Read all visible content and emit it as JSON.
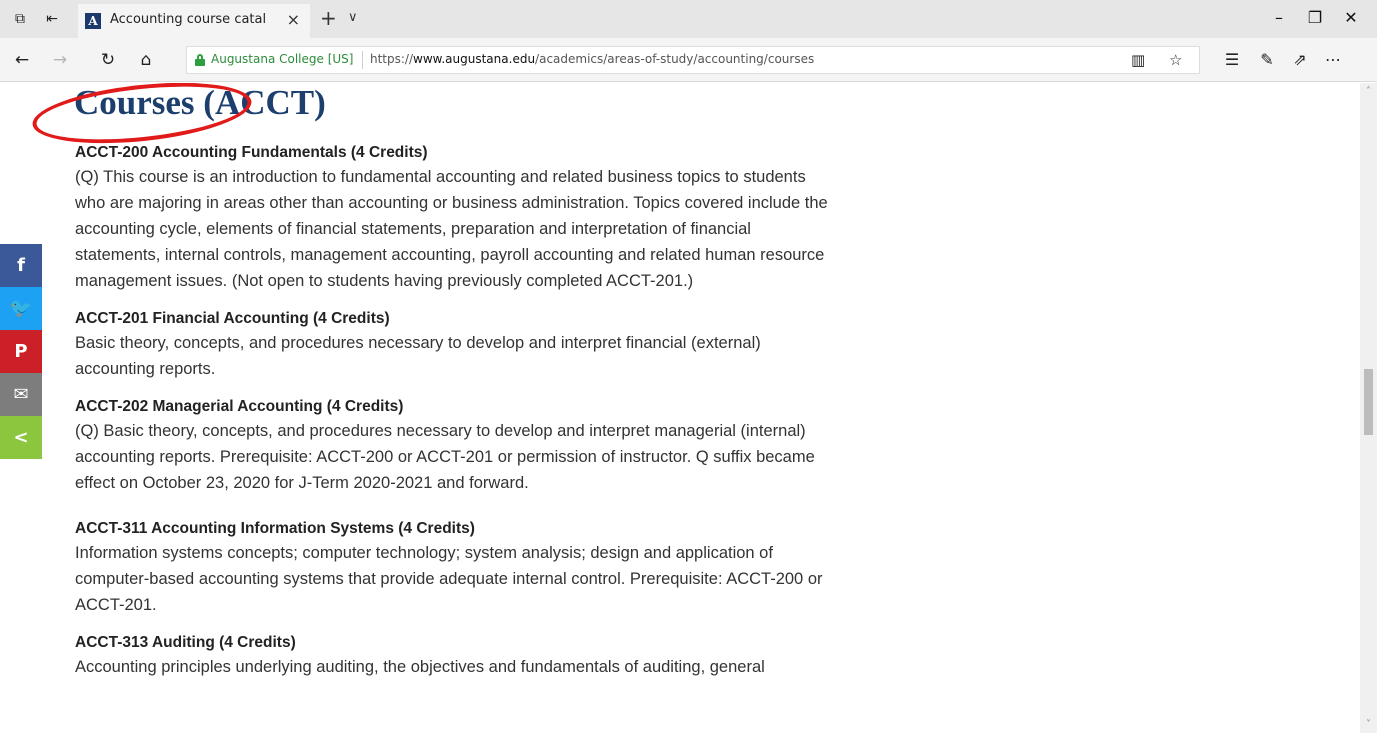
{
  "browser": {
    "tab_title": "Accounting course catal",
    "tab_close": "×",
    "new_tab": "+",
    "tab_menu": "∨",
    "site_identity": "Augustana College [US]",
    "url_prefix": "https://",
    "url_host": "www.augustana.edu",
    "url_path": "/academics/areas-of-study/accounting/courses",
    "window_minimize": "–",
    "window_restore": "❐",
    "window_close": "✕"
  },
  "page": {
    "title": "Courses (ACCT)",
    "annotation_color": "#e11a1a",
    "title_color": "#1c3f6e"
  },
  "courses": [
    {
      "heading": "ACCT-200 Accounting Fundamentals (4 Credits)",
      "lines": [
        "(Q) This course is an introduction to fundamental accounting and related business topics to students",
        "who are majoring in areas other than accounting or business administration. Topics covered include the",
        "accounting cycle, elements of financial statements, preparation and interpretation of financial",
        "statements, internal controls, management accounting, payroll accounting and related human resource",
        "management issues. (Not open to students having previously completed ACCT-201.)"
      ]
    },
    {
      "heading": "ACCT-201 Financial Accounting (4 Credits)",
      "lines": [
        "Basic theory, concepts, and procedures necessary to develop and interpret financial (external)",
        "accounting reports."
      ]
    },
    {
      "heading": "ACCT-202 Managerial Accounting (4 Credits)",
      "lines": [
        "(Q) Basic theory, concepts, and procedures necessary to develop and interpret managerial (internal)",
        "accounting reports. Prerequisite: ACCT-200 or ACCT-201 or permission of instructor. Q suffix became",
        "effect on October 23, 2020 for J-Term 2020-2021 and forward."
      ]
    },
    {
      "heading": "ACCT-311 Accounting Information Systems (4 Credits)",
      "lines": [
        "Information systems concepts; computer technology; system analysis; design and application of",
        "computer-based accounting systems that provide adequate internal control. Prerequisite: ACCT-200 or",
        "ACCT-201."
      ]
    },
    {
      "heading": "ACCT-313 Auditing (4 Credits)",
      "lines": [
        "Accounting principles underlying auditing, the objectives and fundamentals of auditing, general"
      ]
    }
  ],
  "share": {
    "facebook": "f",
    "twitter": "🐦",
    "pinterest": "P",
    "email": "✉",
    "share": "<",
    "colors": {
      "facebook": "#3b5998",
      "twitter": "#1da1f2",
      "pinterest": "#cb2027",
      "email": "#7d7d7d",
      "share": "#8cc63f"
    }
  }
}
